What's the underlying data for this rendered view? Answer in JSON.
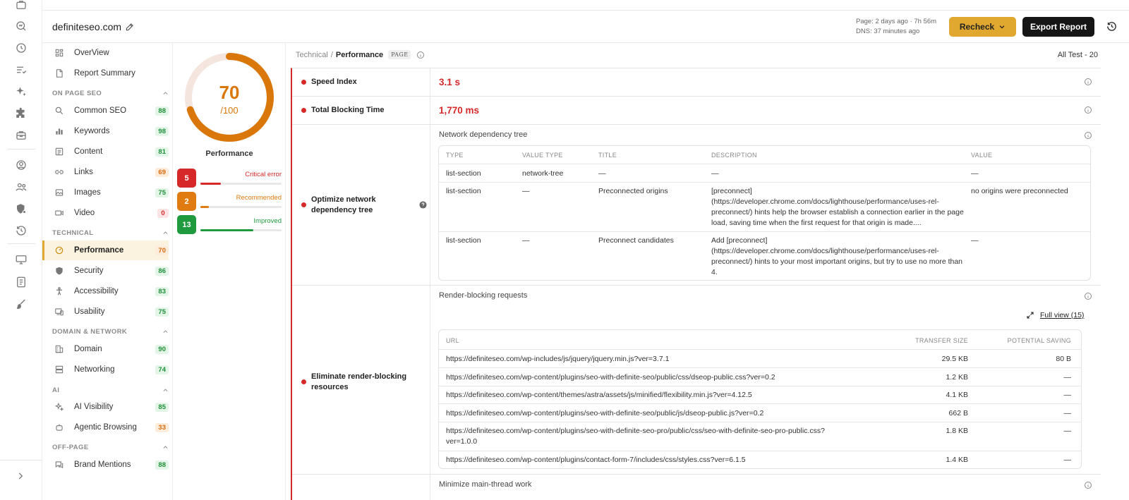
{
  "header": {
    "site_title": "definiteseo.com",
    "meta_page": "Page: 2 days ago · 7h 56m",
    "meta_dns": "DNS: 37 minutes ago",
    "recheck_label": "Recheck",
    "export_label": "Export Report"
  },
  "nav": {
    "top_items": [
      {
        "label": "OverView",
        "icon": "grid-icon"
      },
      {
        "label": "Report Summary",
        "icon": "document-icon"
      }
    ],
    "sections": {
      "on_page": "ON PAGE SEO",
      "technical": "TECHNICAL",
      "domain": "DOMAIN & NETWORK",
      "ai": "AI",
      "off_page": "OFF-PAGE"
    },
    "items": [
      {
        "label": "Common SEO",
        "badge": "88",
        "status": "green",
        "icon": "search-icon"
      },
      {
        "label": "Keywords",
        "badge": "98",
        "status": "green",
        "icon": "bar-chart-icon"
      },
      {
        "label": "Content",
        "badge": "81",
        "status": "green",
        "icon": "content-icon"
      },
      {
        "label": "Links",
        "badge": "69",
        "status": "orange",
        "icon": "link-icon"
      },
      {
        "label": "Images",
        "badge": "75",
        "status": "green",
        "icon": "image-icon"
      },
      {
        "label": "Video",
        "badge": "0",
        "status": "red",
        "icon": "video-icon"
      },
      {
        "label": "Performance",
        "badge": "70",
        "status": "orange",
        "icon": "speedometer-icon"
      },
      {
        "label": "Security",
        "badge": "86",
        "status": "green",
        "icon": "shield-icon"
      },
      {
        "label": "Accessibility",
        "badge": "83",
        "status": "green",
        "icon": "accessibility-icon"
      },
      {
        "label": "Usability",
        "badge": "75",
        "status": "green",
        "icon": "devices-icon"
      },
      {
        "label": "Domain",
        "badge": "90",
        "status": "green",
        "icon": "building-icon"
      },
      {
        "label": "Networking",
        "badge": "74",
        "status": "green",
        "icon": "server-icon"
      },
      {
        "label": "AI Visibility",
        "badge": "85",
        "status": "green",
        "icon": "sparkle-icon"
      },
      {
        "label": "Agentic Browsing",
        "badge": "33",
        "status": "orange",
        "icon": "robot-icon"
      },
      {
        "label": "Brand Mentions",
        "badge": "88",
        "status": "green",
        "icon": "chat-icon"
      }
    ]
  },
  "score": {
    "value": "70",
    "denominator": "/100",
    "fraction": 0.7,
    "caption": "Performance",
    "issues": [
      {
        "count": "5",
        "label": "Critical error",
        "fill": 0.25
      },
      {
        "count": "2",
        "label": "Recommended",
        "fill": 0.1
      },
      {
        "count": "13",
        "label": "Improved",
        "fill": 0.65
      }
    ]
  },
  "main": {
    "breadcrumb_parent": "Technical",
    "breadcrumb_sep": "/",
    "breadcrumb_current": "Performance",
    "page_tag": "PAGE",
    "all_test": "All Test - 20",
    "speed_index": {
      "name": "Speed Index",
      "value": "3.1 s"
    },
    "tbt": {
      "name": "Total Blocking Time",
      "value": "1,770 ms"
    },
    "network": {
      "name": "Optimize network dependency tree",
      "title": "Network dependency tree",
      "headers": [
        "TYPE",
        "VALUE TYPE",
        "TITLE",
        "DESCRIPTION",
        "VALUE"
      ],
      "rows": [
        {
          "type": "list-section",
          "value_type": "network-tree",
          "title": "—",
          "description": "—",
          "value": "—"
        },
        {
          "type": "list-section",
          "value_type": "—",
          "title": "Preconnected origins",
          "description": "[preconnect] (https://developer.chrome.com/docs/lighthouse/performance/uses-rel-preconnect/) hints help the browser establish a connection earlier in the page load, saving time when the first request for that origin is made....",
          "value": "no origins were preconnected"
        },
        {
          "type": "list-section",
          "value_type": "—",
          "title": "Preconnect candidates",
          "description": "Add [preconnect] (https://developer.chrome.com/docs/lighthouse/performance/uses-rel-preconnect/) hints to your most important origins, but try to use no more than 4.",
          "value": "—"
        }
      ]
    },
    "render_blocking": {
      "name": "Eliminate render-blocking resources",
      "title": "Render-blocking requests",
      "full_view": "Full view (15)",
      "headers": [
        "URL",
        "TRANSFER SIZE",
        "POTENTIAL SAVING"
      ],
      "rows": [
        {
          "url": "https://definiteseo.com/wp-includes/js/jquery/jquery.min.js?ver=3.7.1",
          "size": "29.5 KB",
          "saving": "80 B"
        },
        {
          "url": "https://definiteseo.com/wp-content/plugins/seo-with-definite-seo/public/css/dseop-public.css?ver=0.2",
          "size": "1.2 KB",
          "saving": "—"
        },
        {
          "url": "https://definiteseo.com/wp-content/themes/astra/assets/js/minified/flexibility.min.js?ver=4.12.5",
          "size": "4.1 KB",
          "saving": "—"
        },
        {
          "url": "https://definiteseo.com/wp-content/plugins/seo-with-definite-seo/public/js/dseop-public.js?ver=0.2",
          "size": "662 B",
          "saving": "—"
        },
        {
          "url": "https://definiteseo.com/wp-content/plugins/seo-with-definite-seo-pro/public/css/seo-with-definite-seo-pro-public.css?ver=1.0.0",
          "size": "1.8 KB",
          "saving": "—"
        },
        {
          "url": "https://definiteseo.com/wp-content/plugins/contact-form-7/includes/css/styles.css?ver=6.1.5",
          "size": "1.4 KB",
          "saving": "—"
        }
      ]
    },
    "main_thread": {
      "title": "Minimize main-thread work"
    }
  },
  "colors": {
    "accent": "#e0a82e",
    "score": "#d9770a",
    "critical": "#d62828",
    "recommended": "#e07b12",
    "improved": "#1f9a3e"
  }
}
